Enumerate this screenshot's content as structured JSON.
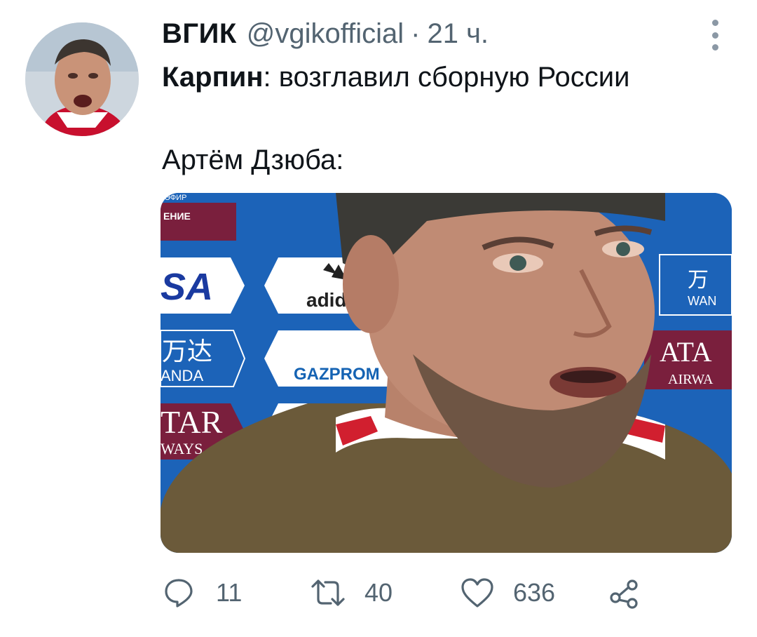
{
  "tweet": {
    "author_name": "ВГИК",
    "author_handle": "@vgikofficial",
    "separator": "·",
    "time": "21 ч.",
    "line1_bold": "Карпин",
    "line1_rest": ": возглавил сборную России",
    "line2": "Артём Дзюба:"
  },
  "media": {
    "board_texts": {
      "top_label": "ЭФИР",
      "tag": "ЕНИЕ",
      "visa": "SA",
      "adidas": "adid",
      "wanda_cn": "万达",
      "wanda": "ANDA",
      "gazprom": "GAZPROM",
      "qatar_left": "TAR",
      "airways_left": "WAYS",
      "wanda_right_cn": "万",
      "wanda_right": "WAN",
      "qatar_right": "ATA",
      "airways_right": "AIRWA"
    }
  },
  "actions": {
    "reply_count": "11",
    "retweet_count": "40",
    "like_count": "636"
  },
  "icons": [
    "reply-icon",
    "retweet-icon",
    "like-icon",
    "share-icon",
    "more-options-icon"
  ],
  "colors": {
    "text": "#0f1419",
    "secondary": "#536471",
    "board_blue": "#1c63b8",
    "board_maroon": "#7a1f3d"
  }
}
